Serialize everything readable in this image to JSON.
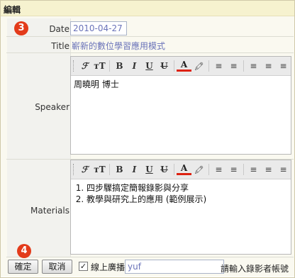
{
  "panel": {
    "title": "編輯"
  },
  "badges": {
    "step_a": "3",
    "step_b": "4"
  },
  "fields": {
    "date_label": "Date",
    "date_value": "2010-04-27",
    "title_label": "Title",
    "title_value": "嶄新的數位學習應用模式",
    "speaker_label": "Speaker",
    "materials_label": "Materials"
  },
  "toolbar": {
    "font_family": "ℱ",
    "font_size": "тT",
    "bold": "B",
    "italic": "I",
    "underline": "U",
    "strike": "U",
    "font_color": "A",
    "highlight": "🖍",
    "ordered_list": "≡",
    "unordered_list": "≡",
    "align_left": "≡",
    "align_center": "≡",
    "align_right": "≡"
  },
  "speaker_editor": {
    "content": "周曉明 博士"
  },
  "materials_editor": {
    "items": [
      "四步驟搞定簡報錄影與分享",
      "教學與研究上的應用 (範例展示)"
    ]
  },
  "actions": {
    "confirm_label": "確定",
    "cancel_label": "取消",
    "live_checkbox_checked": true,
    "live_label": "線上廣播",
    "user_value": "yuf",
    "user_hint": "請輸入錄影者帳號"
  },
  "colors": {
    "badge": "#e33b1a",
    "header_bg": "#f6f2cf",
    "value_text": "#6a73b9"
  }
}
